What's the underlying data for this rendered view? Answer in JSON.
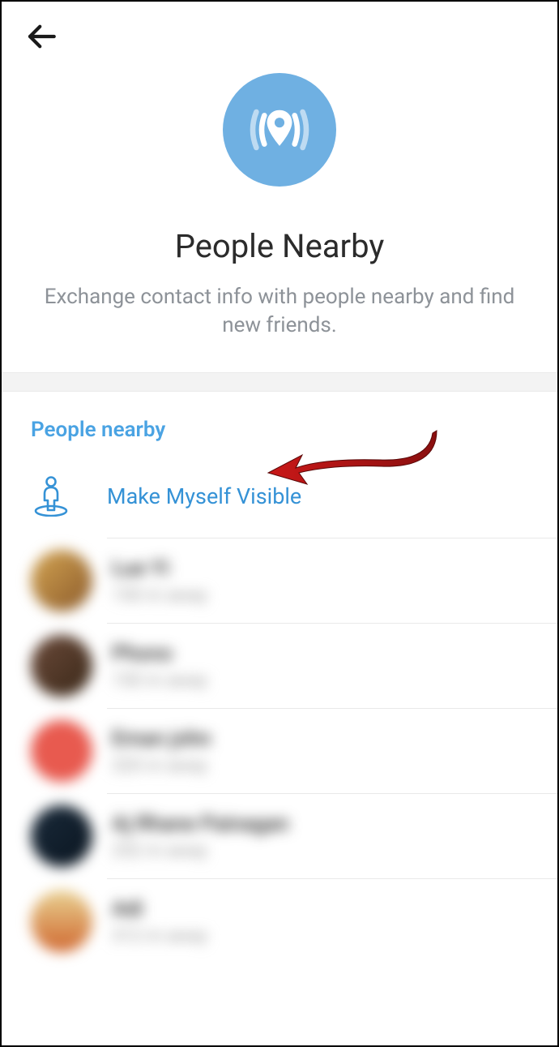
{
  "header": {
    "title": "People Nearby",
    "subtitle": "Exchange contact info with people nearby and find new friends."
  },
  "section": {
    "header": "People nearby",
    "action_label": "Make Myself Visible"
  },
  "people": [
    {
      "name": "Lue Yi",
      "distance": "150 m away",
      "avatar_color": "linear-gradient(135deg,#d4a552,#8b5a2b)"
    },
    {
      "name": "Phono",
      "distance": "150 m away",
      "avatar_color": "linear-gradient(135deg,#6b4a3a,#3a2818)"
    },
    {
      "name": "Eman john",
      "distance": "320 m away",
      "avatar_color": "#e85a4f"
    },
    {
      "name": "Aj Rhane Painagan",
      "distance": "252 m away",
      "avatar_color": "linear-gradient(135deg,#1a2a3a,#0a1520)"
    },
    {
      "name": "Adi",
      "distance": "312 m away",
      "avatar_color": "linear-gradient(180deg,#e8d090,#d06830)"
    }
  ],
  "colors": {
    "accent": "#4aa3e3",
    "hero_bg": "#6fb0e2"
  }
}
